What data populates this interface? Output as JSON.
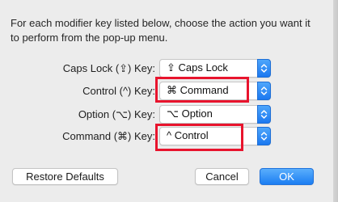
{
  "instructions": "For each modifier key listed below, choose the action you want it to perform from the pop-up menu.",
  "rows": [
    {
      "label": "Caps Lock (⇪) Key:",
      "value": "⇪ Caps Lock"
    },
    {
      "label": "Control (^) Key:",
      "value": "⌘ Command"
    },
    {
      "label": "Option (⌥) Key:",
      "value": "⌥ Option"
    },
    {
      "label": "Command (⌘) Key:",
      "value": "^ Control"
    }
  ],
  "buttons": {
    "restore_defaults": "Restore Defaults",
    "cancel": "Cancel",
    "ok": "OK"
  },
  "colors": {
    "accent": "#1c7ef2",
    "highlight": "#e8142d"
  },
  "icons": {
    "popup_stepper": "updown-chevron-icon"
  }
}
